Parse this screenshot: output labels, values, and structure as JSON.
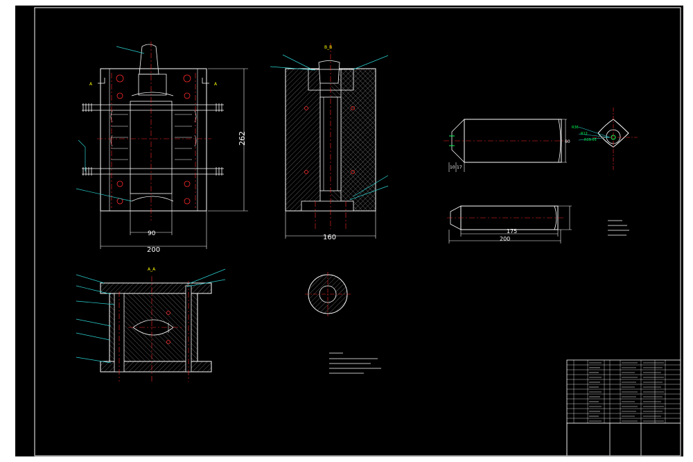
{
  "drawing": {
    "colors": {
      "background": "#000000",
      "paper": "#ffffff",
      "outline": "#ffffff",
      "dimension": "#ffffff",
      "center_line": "#ff2a2a",
      "hatch": "#9a9a9a",
      "leader": "#2dd4d4",
      "section_label": "#ffff00",
      "feature": "#00ff55"
    },
    "labels": {
      "section_bb": "B_B",
      "section_aa": "A_A",
      "section_a": "A",
      "section_b": "B"
    },
    "dimensions": {
      "front_height": "262",
      "front_width": "200",
      "front_inner": "90",
      "side_width": "160",
      "part_length": "175",
      "part_total": "200",
      "part_small_1": "10",
      "part_small_2": "17",
      "part_dia": "60",
      "part_r1": "R36",
      "part_r2": "R12",
      "part_r3": "R19.05"
    }
  }
}
